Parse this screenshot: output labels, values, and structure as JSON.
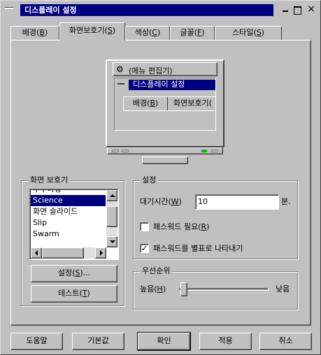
{
  "window": {
    "title": "디스플레이 설정"
  },
  "tabs": [
    {
      "label": "배경",
      "key": "B"
    },
    {
      "label": "화면보호기",
      "key": "S"
    },
    {
      "label": "색상",
      "key": "C"
    },
    {
      "label": "글꼴",
      "key": "F"
    },
    {
      "label": "스타일",
      "key": "S"
    }
  ],
  "preview": {
    "menu_label": "(메뉴 편집기)",
    "inner_title": "디스플레이 설정",
    "inner_tabs": [
      {
        "label": "배경",
        "key": "B"
      },
      {
        "label": "화면보호기(",
        "key": ""
      }
    ]
  },
  "screensaver_group": {
    "title": "화면 보호기",
    "items": [
      "우주여행",
      "Science",
      "화면 슬라이드",
      "Slip",
      "Swarm"
    ],
    "selected": "Science",
    "settings_button": {
      "label": "설정",
      "key": "S",
      "suffix": "..."
    },
    "test_button": {
      "label": "테스트",
      "key": "T"
    }
  },
  "settings_group": {
    "title": "설정",
    "wait_label": "대기시간",
    "wait_key": "W",
    "wait_value": "10",
    "wait_unit": "분.",
    "password_required": {
      "label": "패스워드 필요",
      "key": "R",
      "checked": false
    },
    "password_separate": {
      "label": "패스워드를",
      "key": "p",
      "label_rest": " 별표로 나타내기",
      "checked": true
    }
  },
  "priority_group": {
    "title": "우선순위",
    "low_label": "높음",
    "low_key": "H",
    "high_label": "낮음",
    "level": 0
  },
  "buttons": {
    "help": "도움말",
    "default": "기본값",
    "ok": "확인",
    "apply": "적용",
    "cancel": "취소"
  }
}
